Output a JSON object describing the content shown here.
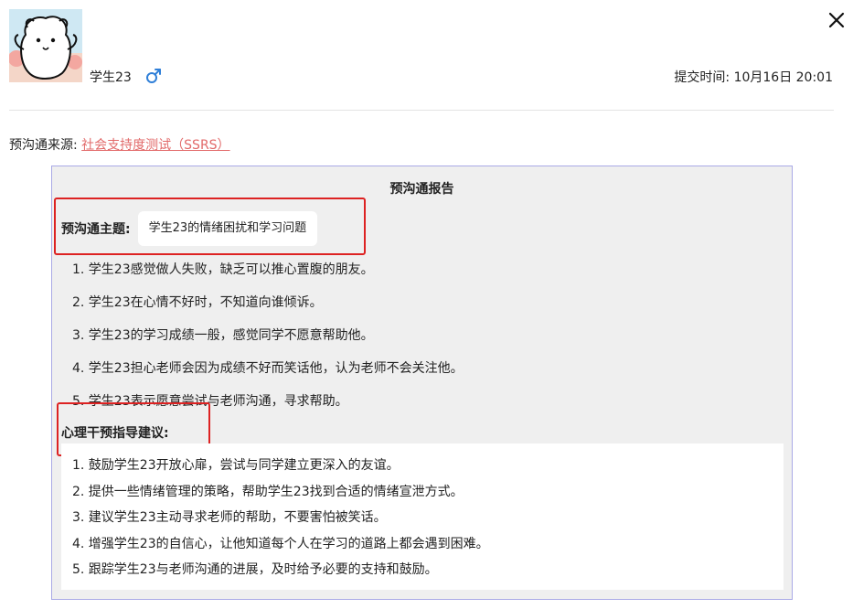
{
  "header": {
    "student_name": "学生23",
    "gender_icon": "male-icon",
    "submit_time": "提交时间: 10月16日 20:01",
    "avatar_icon": "bear-avatar",
    "close_icon": "close-icon"
  },
  "source": {
    "label": "预沟通来源: ",
    "link_text": "社会支持度测试（SSRS）",
    "link_color": "#e26a6a"
  },
  "report": {
    "title": "预沟通报告",
    "topic_label": "预沟通主题:",
    "topic_value": "学生23的情绪困扰和学习问题",
    "issues": [
      "1. 学生23感觉做人失败，缺乏可以推心置腹的朋友。",
      "2. 学生23在心情不好时，不知道向谁倾诉。",
      "3. 学生23的学习成绩一般，感觉同学不愿意帮助他。",
      "4. 学生23担心老师会因为成绩不好而笑话他，认为老师不会关注他。",
      "5. 学生23表示愿意尝试与老师沟通，寻求帮助。"
    ],
    "advice_label": "心理干预指导建议:",
    "advice": [
      "1. 鼓励学生23开放心扉，尝试与同学建立更深入的友谊。",
      "2. 提供一些情绪管理的策略，帮助学生23找到合适的情绪宣泄方式。",
      "3. 建议学生23主动寻求老师的帮助，不要害怕被笑话。",
      "4. 增强学生23的自信心，让他知道每个人在学习的道路上都会遇到困难。",
      "5. 跟踪学生23与老师沟通的进展，及时给予必要的支持和鼓励。"
    ]
  },
  "colors": {
    "highlight": "#dd2222",
    "card_border": "#a9a9e6",
    "card_bg": "#efefef",
    "gender_male": "#2f7fd8"
  }
}
